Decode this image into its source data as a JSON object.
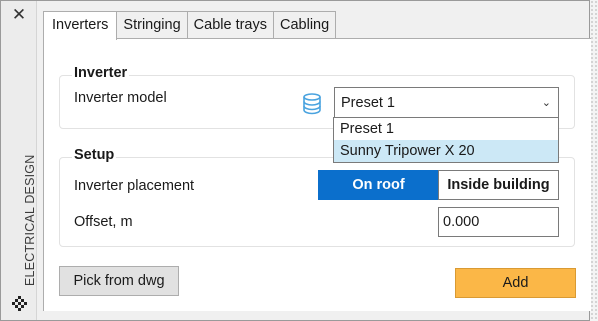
{
  "palette": {
    "side_title": "ELECTRICAL DESIGN",
    "close_icon": "close-icon",
    "grip_icon": "grip-icon"
  },
  "tabs": [
    {
      "label": "Inverters",
      "active": true
    },
    {
      "label": "Stringing",
      "active": false
    },
    {
      "label": "Cable trays",
      "active": false
    },
    {
      "label": "Cabling",
      "active": false
    }
  ],
  "inverter": {
    "group_title": "Inverter",
    "model_label": "Inverter model",
    "database_icon": "database-icon",
    "model_value": "Preset 1",
    "options": [
      "Preset 1",
      "Sunny Tripower X 20"
    ],
    "highlighted_option": "Sunny Tripower X 20"
  },
  "setup": {
    "group_title": "Setup",
    "placement_label": "Inverter placement",
    "placement_options": [
      "On roof",
      "Inside building"
    ],
    "placement_selected": "On roof",
    "offset_label": "Offset, m",
    "offset_value": "0.000"
  },
  "actions": {
    "pick_label": "Pick from dwg",
    "add_label": "Add"
  },
  "colors": {
    "accent_blue": "#0b6fcc",
    "add_button": "#fbb747",
    "highlight": "#cce8f6",
    "database_icon": "#4aa3df"
  }
}
